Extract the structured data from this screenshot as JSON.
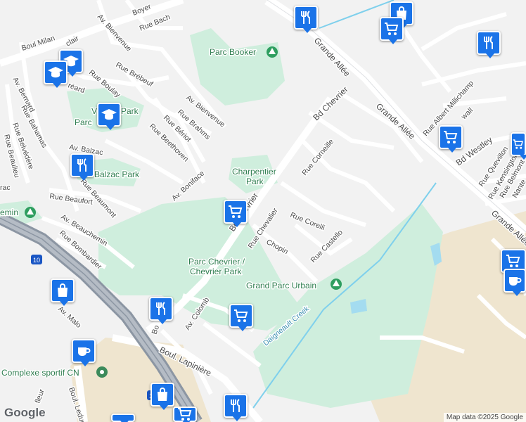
{
  "map": {
    "streets": {
      "boul_milan": "Boul Milan",
      "boyer": "Boyer",
      "rue_bach": "Rue Bach",
      "av_bienvenue_n": "Av. Bienvenue",
      "clair": "clair",
      "av_bernard": "Av. Bernard",
      "rue_brebeuf": "Rue Brébeuf",
      "rue_boulay": "Rue Boulay",
      "rue_bahamas": "Rue Bahamas",
      "rue_belvedere": "Rue Belvédère",
      "rue_beaulieu": "Rue Beaulieu",
      "breard": "réard",
      "av_bienvenue_s": "Av. Bienvenue",
      "rue_brahms": "Rue Brahms",
      "rue_beriot": "Rue Bériot",
      "rue_beethoven": "Rue Beethoven",
      "av_balzac": "Av. Balzac",
      "rue_beaumont": "Rue Beaumont",
      "rue_beaufort": "Rue Beaufort",
      "rac": "rac",
      "av_beauchemin": "Av. Beauchemin",
      "rue_bombardier": "Rue Bombardier",
      "av_boniface": "Av. Boniface",
      "bd_chevrier": "Bd Chevrier",
      "chevrier_s": "Bd Chevrier",
      "grande_allee_n": "Grande Allée",
      "grande_allee_mid": "Grande Allée",
      "grande_allee_e": "Grande Allée",
      "rue_corneille": "Rue Corneille",
      "rue_corelli": "Rue Corelli",
      "rue_chevalier": "Rue Chevalier",
      "chopin": "Chopin",
      "rue_castello": "Rue Castello",
      "rue_albert_millichamp": "Rue Albert Millichamp",
      "wall": "wall",
      "bd_westley": "Bd Westley",
      "rue_quevillon": "Rue Quevillon",
      "rue_kensington": "Rue Kensington",
      "rue_belmont": "Rue Belmont",
      "nantes": "Nante",
      "av_colomb": "Av. Colomb",
      "bd_left": "Bo",
      "av_malo": "Av. Malo",
      "boul_lapiniere": "Boul. Lapinière",
      "boul_leduc": "Boul. Leduc",
      "fleur": "fleur",
      "daigneault_creek": "Daigneault Creek",
      "hwy_10_a": "10",
      "hwy_10_b": "10"
    },
    "places": {
      "parc_booker": "Parc Booker",
      "v_park": "V",
      "parc_short": "Parc",
      "park_suffix": "Park",
      "balzac_park": "Balzac Park",
      "charpentier_line1": "Charpentier",
      "charpentier_line2": "Park",
      "beauchemin": "emin",
      "parc_chevrier_line1": "Parc Chevrier /",
      "parc_chevrier_line2": "Chevrier Park",
      "grand_parc_urbain": "Grand Parc Urbain",
      "complexe_sportif": "Complexe sportif CN"
    },
    "markers": [
      {
        "icon": "restaurant-icon"
      },
      {
        "icon": "shopping-bag-icon"
      },
      {
        "icon": "grocery-cart-icon"
      },
      {
        "icon": "restaurant-icon"
      },
      {
        "icon": "school-icon"
      },
      {
        "icon": "school-icon"
      },
      {
        "icon": "school-icon"
      },
      {
        "icon": "grocery-cart-icon"
      },
      {
        "icon": "grocery-cart-icon"
      },
      {
        "icon": "restaurant-icon"
      },
      {
        "icon": "grocery-cart-icon"
      },
      {
        "icon": "shopping-bag-icon"
      },
      {
        "icon": "restaurant-icon"
      },
      {
        "icon": "grocery-cart-icon"
      },
      {
        "icon": "grocery-cart-icon"
      },
      {
        "icon": "cafe-icon"
      },
      {
        "icon": "cafe-icon"
      },
      {
        "icon": "restaurant-icon"
      },
      {
        "icon": "shopping-bag-icon"
      },
      {
        "icon": "grocery-cart-icon"
      },
      {
        "icon": "grocery-cart-icon"
      }
    ],
    "colors": {
      "marker": "#1a73e8",
      "park": "#cfeedd",
      "water": "#a4dcf0",
      "highway": "#8c96a3",
      "industrial": "#efe5cf"
    }
  },
  "footer": {
    "logo": "Google",
    "attribution": "Map data ©2025 Google"
  }
}
